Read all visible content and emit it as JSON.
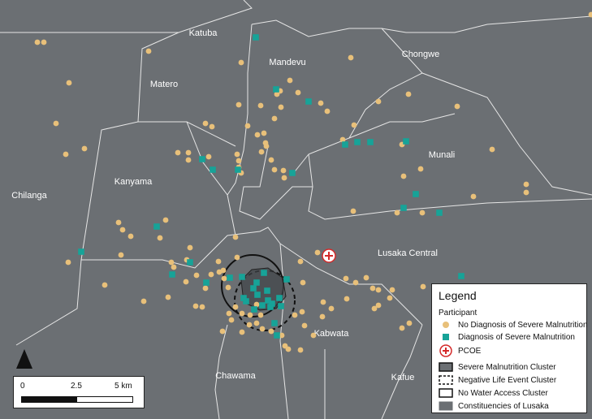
{
  "districts": [
    "Katuba",
    "Mandevu",
    "Chongwe",
    "Matero",
    "Munali",
    "Chilanga",
    "Kanyama",
    "Lusaka Central",
    "Kabwata",
    "Chawama",
    "Kafue"
  ],
  "legend": {
    "title": "Legend",
    "participant_heading": "Participant",
    "no_diagnosis": "No Diagnosis of Severe Malnutrition",
    "diagnosis": "Diagnosis of Severe Malnutrition",
    "pcoe": "PCOE",
    "severe_cluster": "Severe Malnutrition Cluster",
    "negative_cluster": "Negative Life Event Cluster",
    "water_cluster": "No Water Access Cluster",
    "constituencies": "Constituencies of Lusaka"
  },
  "scale": {
    "tick0": "0",
    "tick1": "2.5",
    "tick2": "5 km"
  },
  "colors": {
    "background": "#6b6f73",
    "boundary": "#e6e6e6",
    "no_diagnosis": "#e8c07a",
    "diagnosis": "#17a398",
    "pcoe": "#d42a2a",
    "cluster_fill": "#3f4347"
  }
}
